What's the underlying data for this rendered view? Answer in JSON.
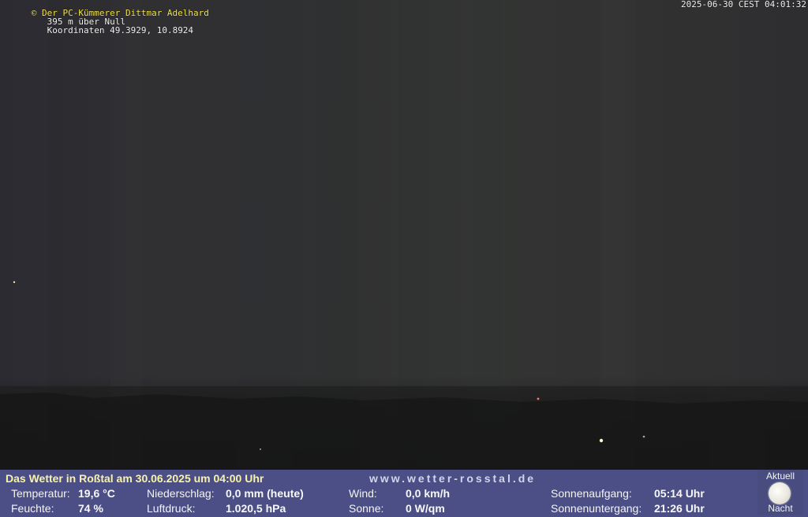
{
  "overlay": {
    "copyright": "© Der PC-Kümmerer Dittmar Adelhard",
    "altitude": "395 m über Null",
    "coordinates": "Koordinaten 49.3929, 10.8924",
    "timestamp": "2025-06-30 CEST 04:01:32"
  },
  "weather": {
    "headline": "Das Wetter in Roßtal am 30.06.2025 um 04:00 Uhr",
    "website": "www.wetter-rosstal.de",
    "temperature_label": "Temperatur:",
    "temperature_value": "19,6 °C",
    "humidity_label": "Feuchte:",
    "humidity_value": "74 %",
    "precip_label": "Niederschlag:",
    "precip_value": "0,0 mm (heute)",
    "pressure_label": "Luftdruck:",
    "pressure_value": "1.020,5 hPa",
    "wind_label": "Wind:",
    "wind_value": "0,0 km/h",
    "sun_label": "Sonne:",
    "sun_value": "0 W/qm",
    "sunrise_label": "Sonnenaufgang:",
    "sunrise_value": "05:14 Uhr",
    "sunset_label": "Sonnenuntergang:",
    "sunset_value": "21:26 Uhr"
  },
  "moon": {
    "top_label": "Aktuell",
    "bottom_label": "Nacht",
    "icon": "full-moon-icon"
  }
}
